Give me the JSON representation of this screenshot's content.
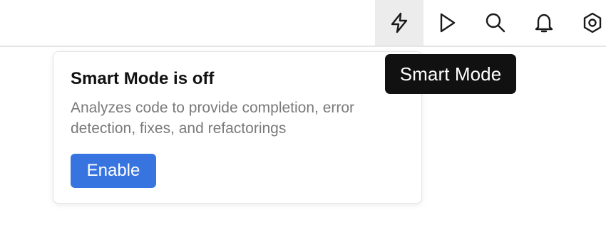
{
  "toolbar": {
    "buttons": [
      {
        "icon": "lightning-icon",
        "state": "hovered"
      },
      {
        "icon": "play-icon"
      },
      {
        "icon": "search-icon"
      },
      {
        "icon": "bell-icon"
      },
      {
        "icon": "gear-icon"
      }
    ]
  },
  "tooltip": {
    "text": "Smart Mode"
  },
  "popup": {
    "title": "Smart Mode is off",
    "description": "Analyzes code to provide completion, error detection, fixes, and refactorings",
    "enable_label": "Enable"
  },
  "colors": {
    "accent": "#3874e0",
    "tooltip_bg": "#111111",
    "active_button_bg": "#ececec",
    "description_text": "#7a7a7a"
  }
}
